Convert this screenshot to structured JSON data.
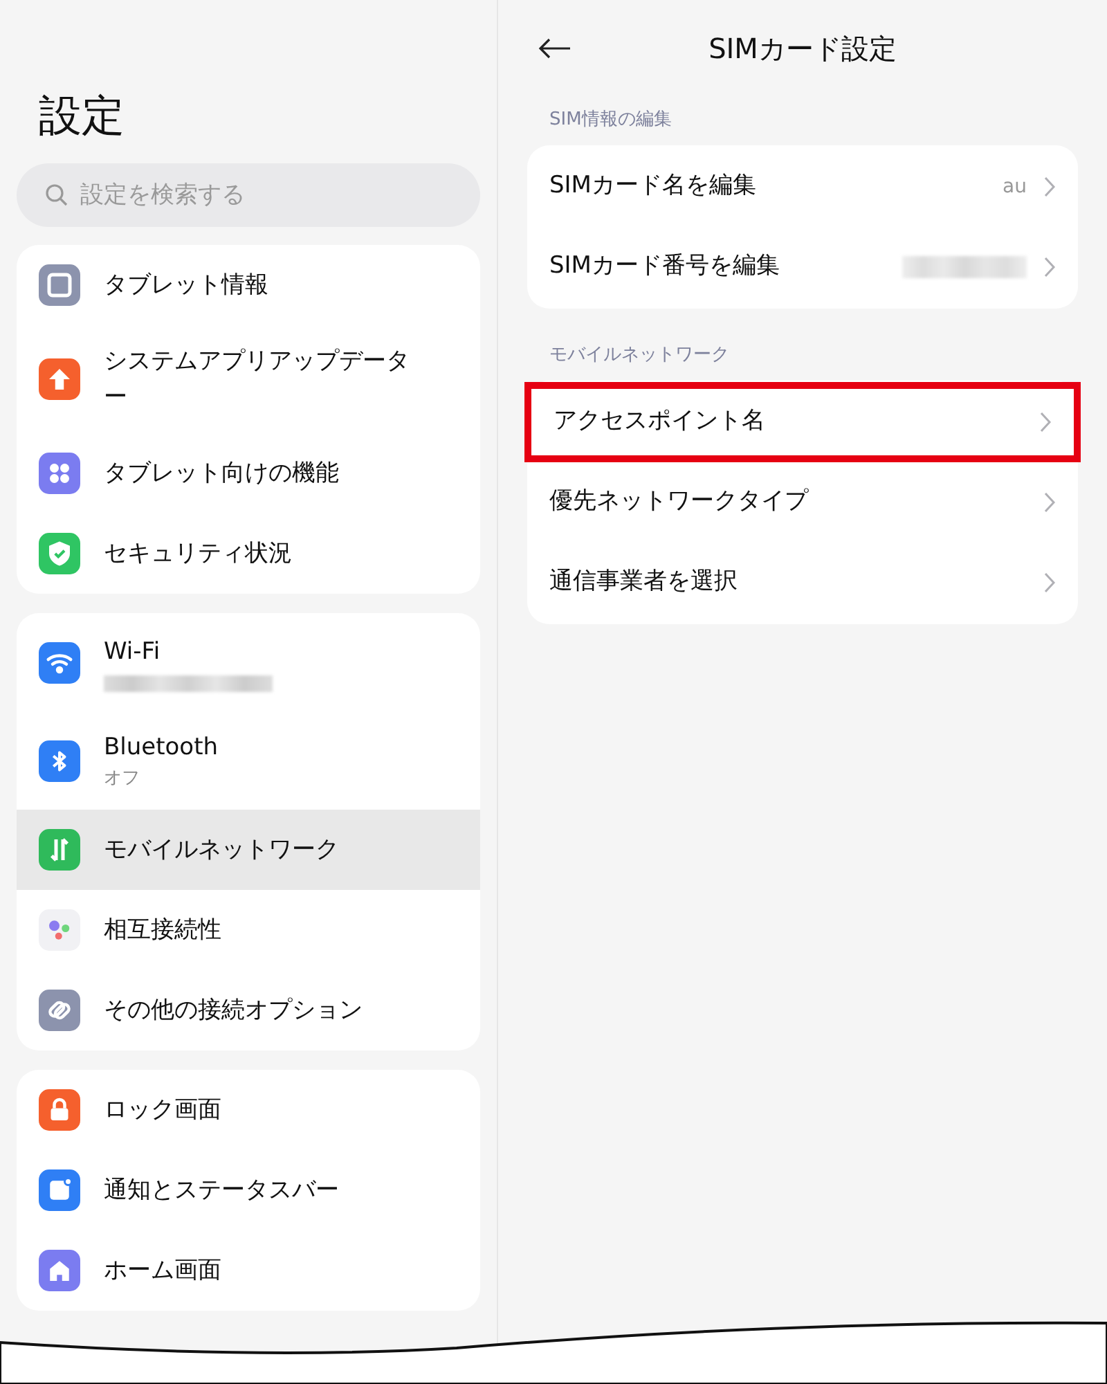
{
  "sidebar": {
    "title": "設定",
    "search": {
      "placeholder": "設定を検索する"
    },
    "groups": [
      {
        "items": [
          {
            "label": "タブレット情報",
            "kind": "device",
            "color": "#8c93ad",
            "selected": false
          },
          {
            "label": "システムアプリアップデーター",
            "kind": "upload",
            "color": "#f5602d",
            "selected": false
          },
          {
            "label": "タブレット向けの機能",
            "kind": "grid",
            "color": "#7b7cf0",
            "selected": false
          },
          {
            "label": "セキュリティ状況",
            "kind": "shield",
            "color": "#2fc563",
            "selected": false
          }
        ]
      },
      {
        "items": [
          {
            "label": "Wi-Fi",
            "kind": "wifi",
            "color": "#2f7ff5",
            "selected": false,
            "redacted_subtitle": true
          },
          {
            "label": "Bluetooth",
            "subtitle": "オフ",
            "kind": "bluetooth",
            "color": "#2f7ff5",
            "selected": false
          },
          {
            "label": "モバイルネットワーク",
            "kind": "updown",
            "color": "#2fba5b",
            "selected": true
          },
          {
            "label": "相互接続性",
            "kind": "dots",
            "color": "#f1f1f4",
            "selected": false
          },
          {
            "label": "その他の接続オプション",
            "kind": "link",
            "color": "#8c93ad",
            "selected": false
          }
        ]
      },
      {
        "items": [
          {
            "label": "ロック画面",
            "kind": "lock",
            "color": "#f5602d",
            "selected": false
          },
          {
            "label": "通知とステータスバー",
            "kind": "notification",
            "color": "#2f7ff5",
            "selected": false
          },
          {
            "label": "ホーム画面",
            "kind": "home",
            "color": "#7b7cf0",
            "selected": false
          }
        ]
      }
    ]
  },
  "detail": {
    "title": "SIMカード設定",
    "sections": [
      {
        "heading": "SIM情報の編集",
        "rows": [
          {
            "label": "SIMカード名を編集",
            "value": "au",
            "highlighted": false
          },
          {
            "label": "SIMカード番号を編集",
            "redacted_value": true,
            "highlighted": false
          }
        ]
      },
      {
        "heading": "モバイルネットワーク",
        "rows": [
          {
            "label": "アクセスポイント名",
            "highlighted": true
          },
          {
            "label": "優先ネットワークタイプ",
            "highlighted": false
          },
          {
            "label": "通信事業者を選択",
            "highlighted": false
          }
        ]
      }
    ]
  }
}
